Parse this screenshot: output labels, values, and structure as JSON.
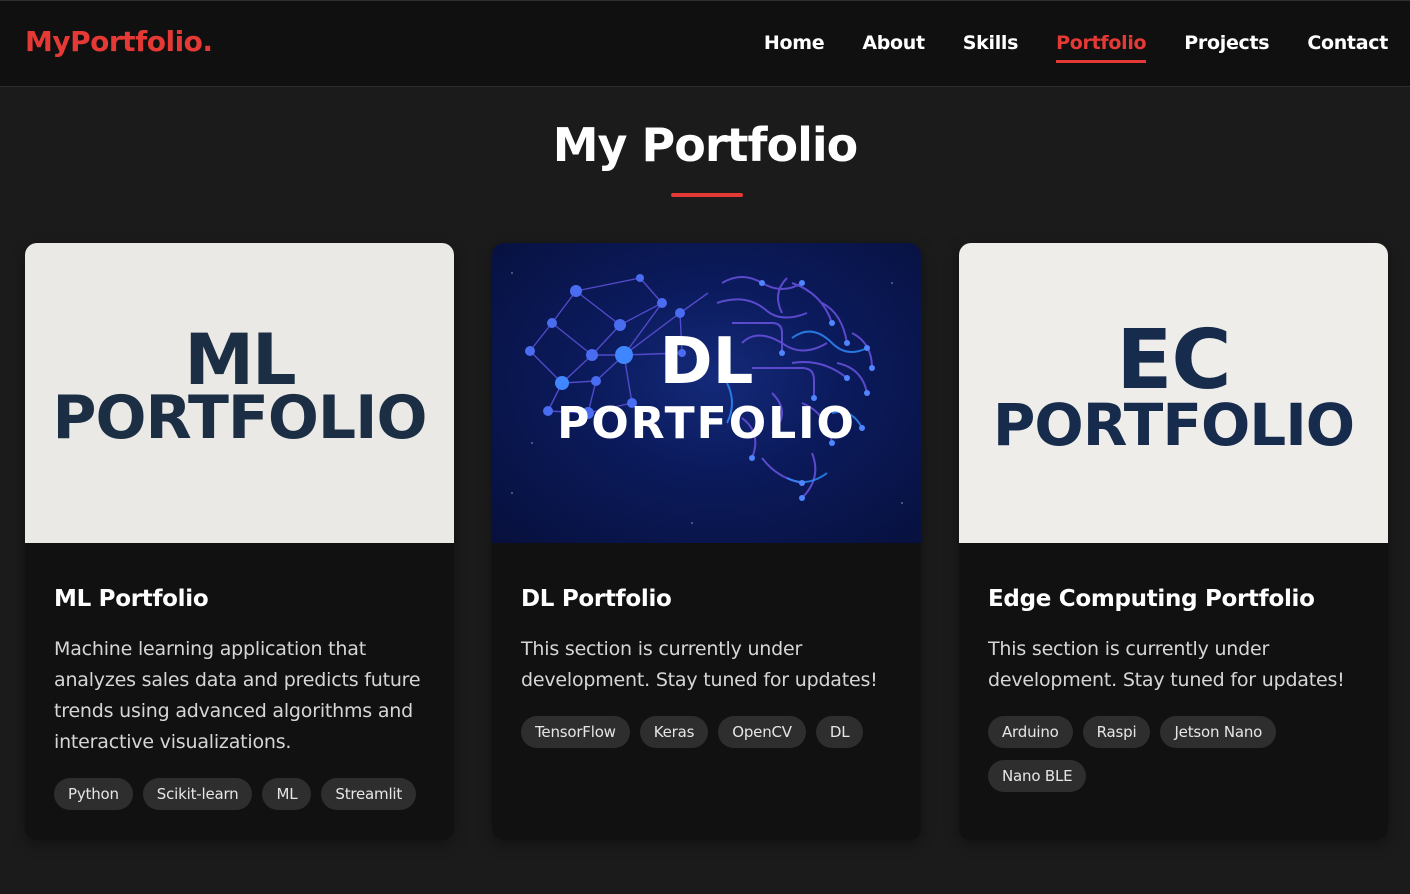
{
  "header": {
    "logo": "MyPortfolio.",
    "nav": [
      {
        "label": "Home",
        "active": false
      },
      {
        "label": "About",
        "active": false
      },
      {
        "label": "Skills",
        "active": false
      },
      {
        "label": "Portfolio",
        "active": true
      },
      {
        "label": "Projects",
        "active": false
      },
      {
        "label": "Contact",
        "active": false
      }
    ]
  },
  "section": {
    "title": "My Portfolio"
  },
  "cards": [
    {
      "cover_line1": "ML",
      "cover_line2": "PORTFOLIO",
      "title": "ML Portfolio",
      "description": "Machine learning application that analyzes sales data and predicts future trends using advanced algorithms and interactive visualizations.",
      "tags": [
        "Python",
        "Scikit-learn",
        "ML",
        "Streamlit"
      ]
    },
    {
      "cover_line1": "DL",
      "cover_line2": "PORTFOLIO",
      "title": "DL Portfolio",
      "description": "This section is currently under development. Stay tuned for updates!",
      "tags": [
        "TensorFlow",
        "Keras",
        "OpenCV",
        "DL"
      ]
    },
    {
      "cover_line1": "EC",
      "cover_line2": "PORTFOLIO",
      "title": "Edge Computing Portfolio",
      "description": "This section is currently under development. Stay tuned for updates!",
      "tags": [
        "Arduino",
        "Raspi",
        "Jetson Nano",
        "Nano BLE"
      ]
    }
  ],
  "colors": {
    "accent": "#e53935",
    "background": "#1b1b1b",
    "card": "#111111",
    "tag": "#2e2e2e"
  }
}
